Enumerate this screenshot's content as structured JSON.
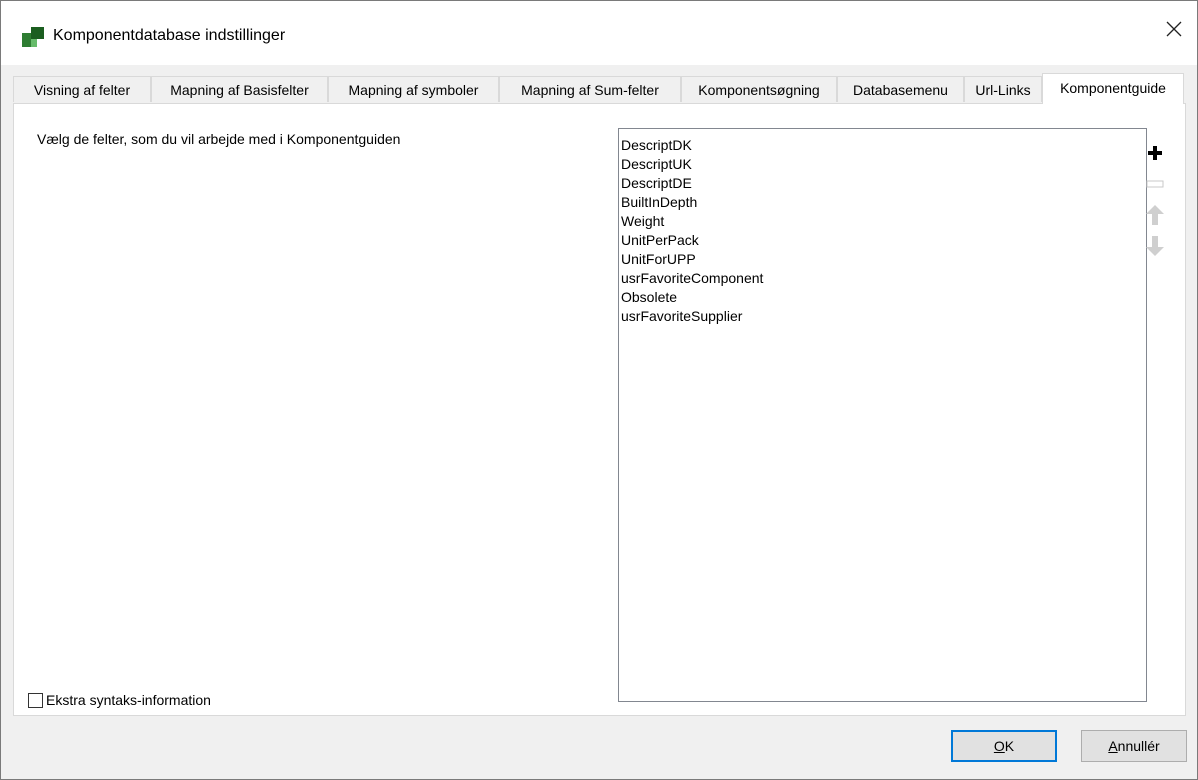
{
  "window": {
    "title": "Komponentdatabase indstillinger"
  },
  "tabs": [
    {
      "label": "Visning af felter",
      "active": false
    },
    {
      "label": "Mapning af Basisfelter",
      "active": false
    },
    {
      "label": "Mapning af symboler",
      "active": false
    },
    {
      "label": "Mapning af Sum-felter",
      "active": false
    },
    {
      "label": "Komponentsøgning",
      "active": false
    },
    {
      "label": "Databasemenu",
      "active": false
    },
    {
      "label": "Url-Links",
      "active": false
    },
    {
      "label": "Komponentguide",
      "active": true
    }
  ],
  "panel": {
    "instruction": "Vælg de felter, som du vil arbejde med i Komponentguiden",
    "fields": [
      "DescriptDK",
      "DescriptUK",
      "DescriptDE",
      "BuiltInDepth",
      "Weight",
      "UnitPerPack",
      "UnitForUPP",
      "usrFavoriteComponent",
      "Obsolete",
      "usrFavoriteSupplier"
    ],
    "buttons": {
      "add_icon": "plus-icon",
      "remove_icon": "minus-icon",
      "up_icon": "arrow-up-icon",
      "down_icon": "arrow-down-icon"
    },
    "checkbox_label": "Ekstra syntaks-information",
    "checkbox_checked": false
  },
  "footer": {
    "ok_label": "OK",
    "ok_mnemonic": "O",
    "ok_rest": "K",
    "cancel_label": "Annullér",
    "cancel_mnemonic": "A",
    "cancel_rest": "nnullér"
  },
  "colors": {
    "accent": "#0078d7",
    "icon_green": "#2e8b57"
  }
}
